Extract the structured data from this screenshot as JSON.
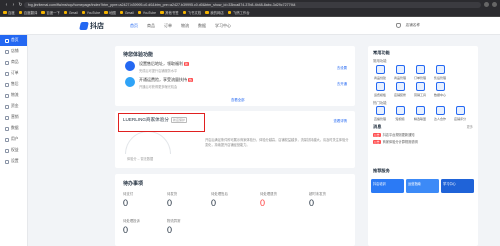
{
  "browser": {
    "url": "fxg.jinritemai.com/ffa/mshop/homepage/index?btm_ppre=a2427.b39995.c0.d0&btm_pre=a2427.b39995.c0.d0&btm_show_id=33bca874-37b8-4b48-8abc-3d29c7277f44",
    "bookmarks": [
      "百度",
      "百度翻译",
      "百度一下",
      "Gmail",
      "YouTube",
      "地图",
      "Gmail",
      "YouTube",
      "其他书签",
      "飞书文档",
      "我的网店",
      "飞鸽工作台"
    ]
  },
  "app": {
    "logo_text": "抖店",
    "top_nav": [
      "首页",
      "商品",
      "订单",
      "物流",
      "数据",
      "学习中心"
    ],
    "user_text": "店铺名称"
  },
  "sidenav": {
    "items": [
      "首页",
      "店铺",
      "商品",
      "订单",
      "售后",
      "物流",
      "资金",
      "营销",
      "数据",
      "用户",
      "权益",
      "设置"
    ]
  },
  "todo": {
    "title": "待您体验功能",
    "rows": [
      {
        "title": "设置售后地址，领取福利",
        "badge": "新",
        "sub": "完成后可提升店铺服务水平",
        "link": "去设置"
      },
      {
        "title": "开通运费险，享受流量扶持",
        "badge": "热",
        "sub": "开通后可获得更多曝光机会",
        "link": "去开通"
      }
    ],
    "more": "查看全部"
  },
  "score": {
    "title": "LUERLING商家体验分",
    "tag": "新店保护",
    "link": "查看详情",
    "gauge_caption": "体验分 -- 暂无数据",
    "desc": "开店后满足条件即可展示商家体验分，体验分越高，店铺权益越多，流量扶持越大。请及时关注体验分变化，持续提升店铺经营能力。"
  },
  "pending": {
    "title": "待办事项",
    "stats": [
      {
        "label": "待支付",
        "value": "0",
        "red": false
      },
      {
        "label": "待发货",
        "value": "0",
        "red": false
      },
      {
        "label": "待处理售后",
        "value": "0",
        "red": false
      },
      {
        "label": "待处理退货",
        "value": "0",
        "red": true
      },
      {
        "label": "超时未发货",
        "value": "0",
        "red": false
      },
      {
        "label": "待处理投诉",
        "value": "0",
        "red": false
      },
      {
        "label": "物流异常",
        "value": "0",
        "red": false
      }
    ]
  },
  "right": {
    "title": "常用功能",
    "sub1": "常用功能",
    "services_row1": [
      "商品创建",
      "商品管理",
      "订单管理",
      "售后管理"
    ],
    "services_row2": [
      "运费模板",
      "店铺装修",
      "营销工具",
      "数据中心"
    ],
    "sub2": "热门功能",
    "services_row3": [
      "直播管理",
      "短视频",
      "精选联盟",
      "达人合作",
      "店铺评分"
    ],
    "notice_title": "消息",
    "notice_more": "更多",
    "notices": [
      {
        "tag": "公告",
        "text": "抖店平台规则更新通知"
      },
      {
        "tag": "公告",
        "text": "商家体验分计算规则说明"
      }
    ],
    "promo_title": "推荐服务",
    "promos": [
      "抖店培训",
      "运营指南",
      "学习中心"
    ]
  },
  "colors": {
    "accent": "#2468f2",
    "highlight": "#e02020",
    "danger": "#ff3b3b"
  }
}
